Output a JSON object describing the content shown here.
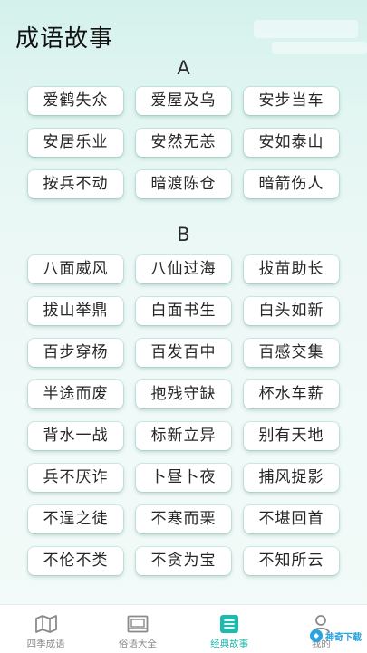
{
  "page": {
    "title": "成语故事"
  },
  "sections": [
    {
      "letter": "A",
      "items": [
        "爱鹤失众",
        "爱屋及乌",
        "安步当车",
        "安居乐业",
        "安然无恙",
        "安如泰山",
        "按兵不动",
        "暗渡陈仓",
        "暗箭伤人"
      ]
    },
    {
      "letter": "B",
      "items": [
        "八面威风",
        "八仙过海",
        "拔苗助长",
        "拔山举鼎",
        "白面书生",
        "白头如新",
        "百步穿杨",
        "百发百中",
        "百感交集",
        "半途而废",
        "抱残守缺",
        "杯水车薪",
        "背水一战",
        "标新立异",
        "别有天地",
        "兵不厌诈",
        "卜昼卜夜",
        "捕风捉影",
        "不逞之徒",
        "不寒而栗",
        "不堪回首",
        "不伦不类",
        "不贪为宝",
        "不知所云"
      ]
    }
  ],
  "tabbar": {
    "tabs": [
      {
        "label": "四季成语",
        "icon": "map-icon",
        "active": false
      },
      {
        "label": "俗语大全",
        "icon": "picture-frame-icon",
        "active": false
      },
      {
        "label": "经典故事",
        "icon": "document-list-icon",
        "active": true
      },
      {
        "label": "我的",
        "icon": "person-icon",
        "active": false
      }
    ]
  },
  "watermark": {
    "text": "神奇下载"
  },
  "colors": {
    "accent": "#20b9ad",
    "chip_bg": "#ffffff",
    "background": "#e3f6f2"
  }
}
